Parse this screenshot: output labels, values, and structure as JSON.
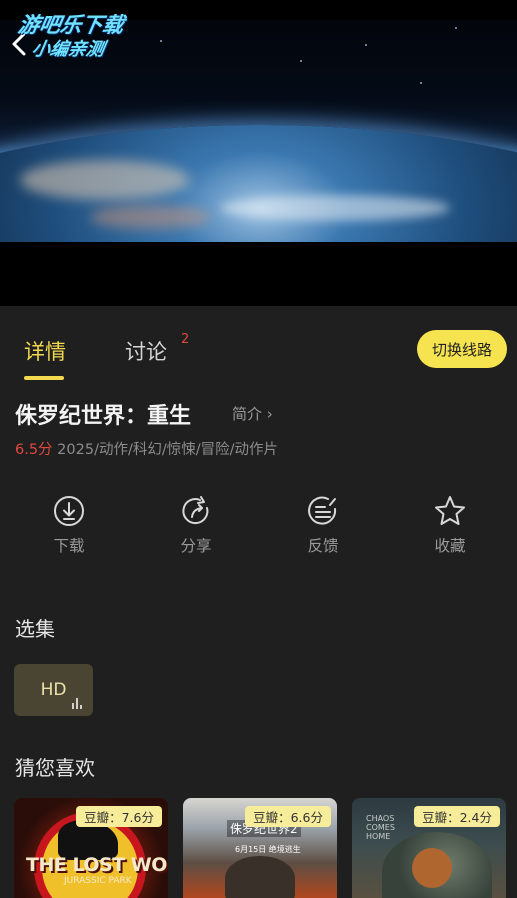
{
  "watermark": {
    "line1": "游吧乐下载",
    "line2": "小编亲测"
  },
  "tabs": [
    {
      "label": "详情"
    },
    {
      "label": "讨论",
      "count": "2"
    }
  ],
  "switch_button": "切换线路",
  "movie": {
    "title": "侏罗纪世界：重生",
    "intro_link": "简介 ›",
    "score": "6.5分",
    "info": " 2025/动作/科幻/惊悚/冒险/动作片"
  },
  "actions": [
    {
      "label": "下载",
      "icon": "download-icon"
    },
    {
      "label": "分享",
      "icon": "share-icon"
    },
    {
      "label": "反馈",
      "icon": "feedback-icon"
    },
    {
      "label": "收藏",
      "icon": "star-icon"
    }
  ],
  "episodes": {
    "heading": "选集",
    "items": [
      "HD"
    ]
  },
  "recommend": {
    "heading": "猜您喜欢",
    "cards": [
      {
        "badge": "豆瓣：7.6分",
        "poster_title": "THE LOST WORLD",
        "poster_sub": "JURASSIC PARK"
      },
      {
        "badge": "豆瓣：6.6分",
        "poster_title": "侏罗纪世界2",
        "poster_sub": "6月15日 绝境逃生"
      },
      {
        "badge": "豆瓣：2.4分",
        "poster_title": "CHAOS COMES HOME"
      }
    ]
  },
  "colors": {
    "accent": "#f2d94e",
    "score_red": "#e0473f",
    "background": "#1f1f1f",
    "button_yellow": "#f5e350"
  }
}
